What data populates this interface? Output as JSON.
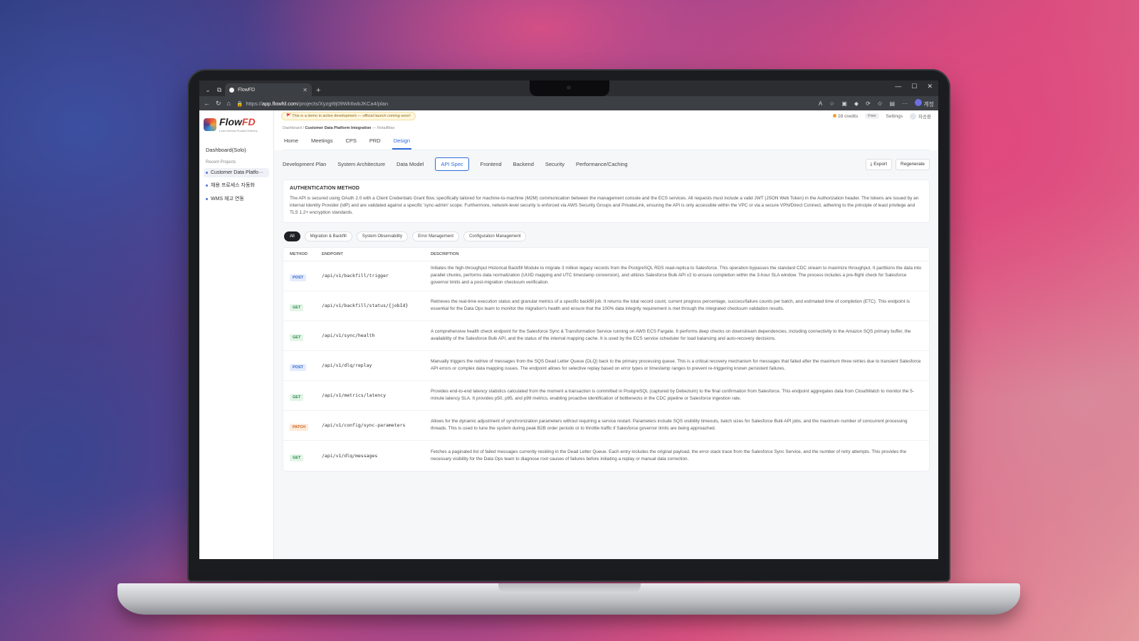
{
  "browser": {
    "tab_title": "FlowFD",
    "url_prefix": "https://",
    "url_host": "app.flowfd.com",
    "url_path": "/projects/Xyzgt9j09Wk6wbJKCa4/plan",
    "profile_label": "계정"
  },
  "app": {
    "logo_main": "Flow",
    "logo_accent": "FD",
    "logo_sub": "Lean Internal Product Delivery",
    "demo_banner": "🚩 This is a demo in active development — official launch coming soon!",
    "credits": "28 credits",
    "plan": "Free",
    "settings": "Settings",
    "user_initial": "차",
    "user_name": "차승환"
  },
  "sidebar": {
    "dashboard": "Dashboard(Solo)",
    "recent_label": "Recent Projects",
    "projects": [
      "Customer Data Platfo···",
      "채용 프로세스 자동화",
      "WMS 재고 연동"
    ]
  },
  "breadcrumb": {
    "root": "Dashboard",
    "sep": "/",
    "project": "Customer Data Platform Integration",
    "org": "— RetailMax"
  },
  "main_tabs": [
    "Home",
    "Meetings",
    "CPS",
    "PRD",
    "Design"
  ],
  "sub_tabs": [
    "Development Plan",
    "System Architecture",
    "Data Model",
    "API Spec",
    "Frontend",
    "Backend",
    "Security",
    "Performance/Caching"
  ],
  "actions": {
    "export": "⤓ Export",
    "regenerate": "Regenerate"
  },
  "auth": {
    "title": "AUTHENTICATION METHOD",
    "body": "The API is secured using OAuth 2.0 with a Client Credentials Grant flow, specifically tailored for machine-to-machine (M2M) communication between the management console and the ECS services. All requests must include a valid JWT (JSON Web Token) in the Authorization header. The tokens are issued by an internal Identity Provider (IdP) and are validated against a specific 'sync-admin' scope. Furthermore, network-level security is enforced via AWS Security Groups and PrivateLink, ensuring the API is only accessible within the VPC or via a secure VPN/Direct Connect, adhering to the principle of least privilege and TLS 1.2+ encryption standards."
  },
  "filters": [
    "All",
    "Migration & Backfill",
    "System Observability",
    "Error Management",
    "Configuration Management"
  ],
  "table": {
    "headers": {
      "method": "METHOD",
      "endpoint": "ENDPOINT",
      "description": "DESCRIPTION"
    },
    "rows": [
      {
        "method": "POST",
        "endpoint": "/api/v1/backfill/trigger",
        "description": "Initiates the high-throughput Historical Backfill Module to migrate 3 million legacy records from the PostgreSQL RDS read-replica to Salesforce. This operation bypasses the standard CDC stream to maximize throughput. It partitions the data into parallel chunks, performs data normalization (UUID mapping and UTC timestamp conversion), and utilizes Salesforce Bulk API v2 to ensure completion within the 3-hour SLA window. The process includes a pre-flight check for Salesforce governor limits and a post-migration checksum verification."
      },
      {
        "method": "GET",
        "endpoint": "/api/v1/backfill/status/{jobId}",
        "description": "Retrieves the real-time execution status and granular metrics of a specific backfill job. It returns the total record count, current progress percentage, success/failure counts per batch, and estimated time of completion (ETC). This endpoint is essential for the Data Ops team to monitor the migration's health and ensure that the 100% data integrity requirement is met through the integrated checksum validation results."
      },
      {
        "method": "GET",
        "endpoint": "/api/v1/sync/health",
        "description": "A comprehensive health check endpoint for the Salesforce Sync & Transformation Service running on AWS ECS Fargate. It performs deep checks on downstream dependencies, including connectivity to the Amazon SQS primary buffer, the availability of the Salesforce Bulk API, and the status of the internal mapping cache. It is used by the ECS service scheduler for load balancing and auto-recovery decisions."
      },
      {
        "method": "POST",
        "endpoint": "/api/v1/dlq/replay",
        "description": "Manually triggers the redrive of messages from the SQS Dead Letter Queue (DLQ) back to the primary processing queue. This is a critical recovery mechanism for messages that failed after the maximum three retries due to transient Salesforce API errors or complex data mapping issues. The endpoint allows for selective replay based on error types or timestamp ranges to prevent re-triggering known persistent failures."
      },
      {
        "method": "GET",
        "endpoint": "/api/v1/metrics/latency",
        "description": "Provides end-to-end latency statistics calculated from the moment a transaction is committed in PostgreSQL (captured by Debezium) to the final confirmation from Salesforce. This endpoint aggregates data from CloudWatch to monitor the 5-minute latency SLA. It provides p50, p95, and p99 metrics, enabling proactive identification of bottlenecks in the CDC pipeline or Salesforce ingestion rate."
      },
      {
        "method": "PATCH",
        "endpoint": "/api/v1/config/sync-parameters",
        "description": "Allows for the dynamic adjustment of synchronization parameters without requiring a service restart. Parameters include SQS visibility timeouts, batch sizes for Salesforce Bulk API jobs, and the maximum number of concurrent processing threads. This is used to tune the system during peak B2B order periods or to throttle traffic if Salesforce governor limits are being approached."
      },
      {
        "method": "GET",
        "endpoint": "/api/v1/dlq/messages",
        "description": "Fetches a paginated list of failed messages currently residing in the Dead Letter Queue. Each entry includes the original payload, the error stack trace from the Salesforce Sync Service, and the number of retry attempts. This provides the necessary visibility for the Data Ops team to diagnose root causes of failures before initiating a replay or manual data correction."
      }
    ]
  }
}
